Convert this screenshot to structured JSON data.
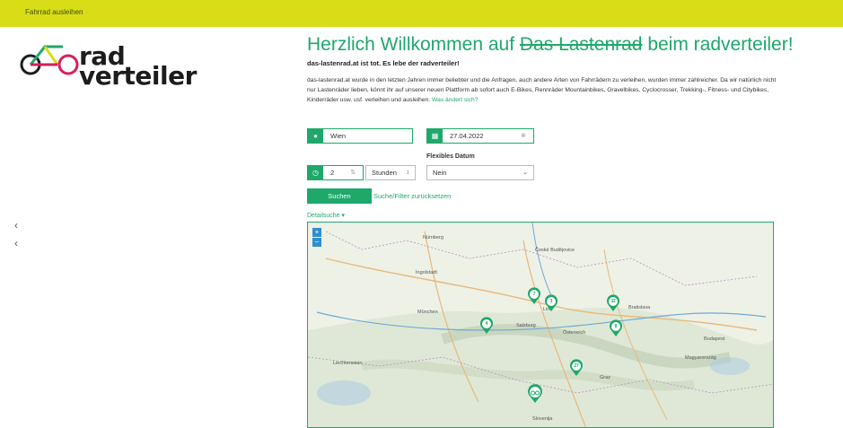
{
  "topbar": {
    "label": "Fahrrad ausleihen"
  },
  "logo": {
    "line1": "rad",
    "line2": "verteiler"
  },
  "heading": {
    "prefix": "Herzlich Willkommen auf ",
    "strike": "Das Lastenrad",
    "suffix": " beim radverteiler!"
  },
  "subheading": "das-lastenrad.at ist tot. Es lebe der radverteiler!",
  "intro": {
    "text": "das-lastenrad.at wurde in den letzten Jahren immer beliebter und die Anfragen, auch andere Arten von Fahrrädern zu verleihen, wurden immer zahlreicher. Da wir natürlich nicht nur Lastenräder lieben, könnt ihr auf unserer neuen Plattform ab sofort auch E-Bikes, Rennräder Mountainbikes, Gravelbikes, Cyclocrosser, Trekking-, Fitness- und Citybikes, Kinderräder usw. usf. verleihen und ausleihen.",
    "link": "Was ändert sich?"
  },
  "form": {
    "location": "Wien",
    "date": "27.04.2022",
    "duration": "2",
    "unit": "Stunden",
    "flex_label": "Flexibles Datum",
    "flex_value": "Nein",
    "search_button": "Suchen",
    "reset_link": "Suche/Filter zurücksetzen",
    "detail_search": "Detailsuche"
  },
  "map": {
    "zoom_in": "+",
    "zoom_out": "−",
    "places": [
      "Nürnberg",
      "České Budějovice",
      "München",
      "Österreich",
      "Bratislava",
      "Budapest",
      "Liechtenstein",
      "Magyarország",
      "Slovenija",
      "Ingolstadt",
      "Salzburg",
      "Linz",
      "Graz"
    ],
    "clusters": [
      "7",
      "3",
      "32",
      "4",
      "8",
      "27"
    ]
  },
  "colors": {
    "accent": "#1ea86a",
    "topbar": "#d9dd17"
  }
}
